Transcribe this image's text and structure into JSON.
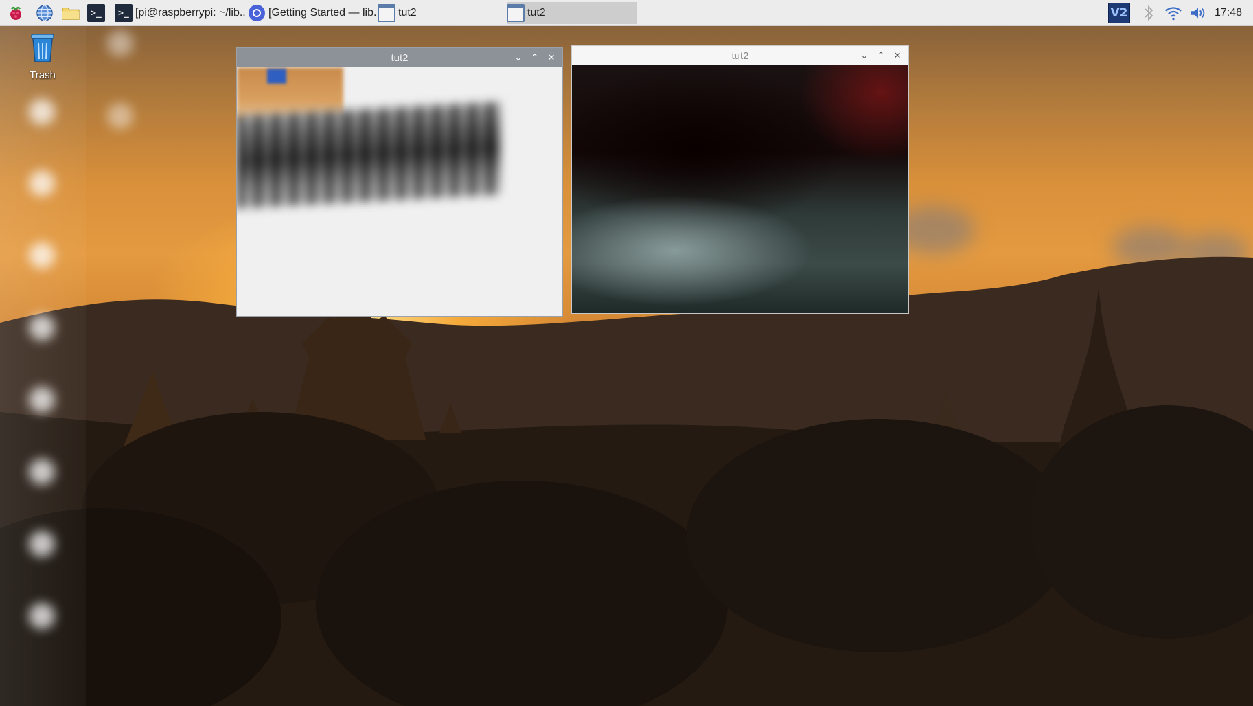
{
  "taskbar": {
    "tasks": [
      {
        "label": "[pi@raspberrypi: ~/lib..."
      },
      {
        "label": "[Getting Started — lib..."
      },
      {
        "label": "tut2"
      },
      {
        "label": "tut2"
      }
    ],
    "tray": {
      "vnc_label": "V2",
      "clock": "17:48"
    }
  },
  "desktop": {
    "icons": [
      {
        "label": "Trash"
      }
    ]
  },
  "windows": [
    {
      "title": "tut2"
    },
    {
      "title": "tut2"
    }
  ],
  "colors": {
    "taskbar_bg": "#ececec",
    "active_task_bg": "#cdcdcd",
    "active_titlebar": "#8d9298",
    "inactive_titlebar": "#f6f6f6",
    "vnc_bg": "#1d3a75"
  }
}
